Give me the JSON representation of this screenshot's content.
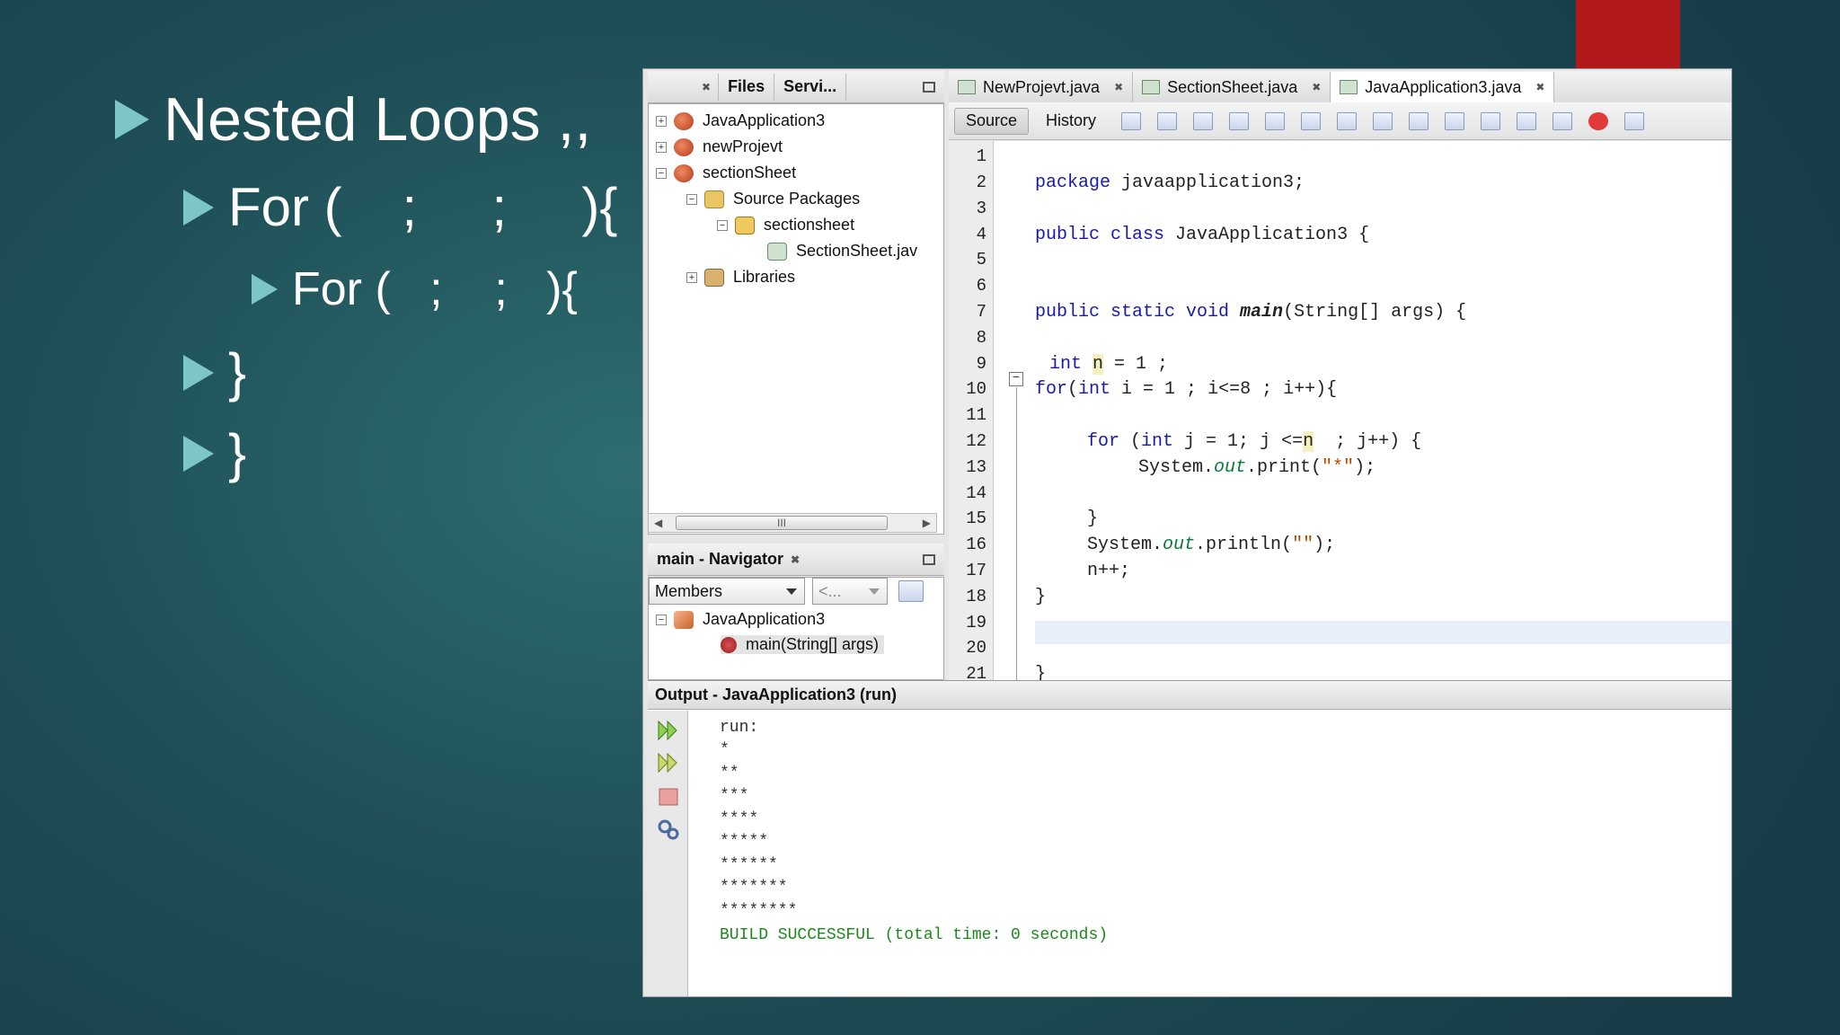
{
  "slide": {
    "bullets": [
      "Nested Loops ,,",
      "For (    ;     ;     ){",
      "For (   ;    ;   ){",
      "}",
      "}"
    ]
  },
  "ide": {
    "projects_panel": {
      "tabs": [
        "Files",
        "Servi..."
      ],
      "tree": [
        {
          "label": "JavaApplication3"
        },
        {
          "label": "newProjevt"
        },
        {
          "label": "sectionSheet"
        },
        {
          "label": "Source Packages"
        },
        {
          "label": "sectionsheet"
        },
        {
          "label": "SectionSheet.jav"
        },
        {
          "label": "Libraries"
        }
      ],
      "scroll_thumb": "III"
    },
    "navigator": {
      "title": "main - Navigator",
      "filter_select": "Members",
      "history_select": "<...",
      "tree": [
        {
          "label": "JavaApplication3"
        },
        {
          "label": "main(String[] args)"
        }
      ]
    },
    "editor_tabs": [
      "NewProjevt.java",
      "SectionSheet.java",
      "JavaApplication3.java"
    ],
    "toolbar": {
      "source": "Source",
      "history": "History"
    },
    "line_numbers": [
      "1",
      "2",
      "3",
      "4",
      "5",
      "6",
      "7",
      "8",
      "9",
      "10",
      "11",
      "12",
      "13",
      "14",
      "15",
      "16",
      "17",
      "18",
      "19",
      "20",
      "21"
    ],
    "code": {
      "l2_kw": "package",
      "l2_rest": " javaapplication3;",
      "l4_kw": "public class",
      "l4_rest": " JavaApplication3 {",
      "l7_kw": "public static void ",
      "l7_m": "main",
      "l7_rest": "(String[] args) {",
      "l9_kw": "int ",
      "l9_n": "n",
      "l9_rest": " = 1 ;",
      "l10_kw": "for",
      "l10_a": "(",
      "l10_kw2": "int",
      "l10_rest": " i = 1 ; i<=8 ; i++){",
      "l12_kw": "for",
      "l12_a": " (",
      "l12_kw2": "int",
      "l12_b": " j = 1; j <=",
      "l12_n": "n",
      "l12_rest": "  ; j++) {",
      "l13_a": "System.",
      "l13_f": "out",
      "l13_b": ".print(",
      "l13_s": "\"*\"",
      "l13_c": ");",
      "l15": "}",
      "l16_a": "System.",
      "l16_f": "out",
      "l16_b": ".println(",
      "l16_s": "\"\"",
      "l16_c": ");",
      "l17": "n++;",
      "l18": "}",
      "l21": "}"
    },
    "output": {
      "title": "Output - JavaApplication3 (run)",
      "lines": [
        "run:",
        "*",
        "**",
        "***",
        "****",
        "*****",
        "******",
        "*******",
        "********"
      ],
      "status": "BUILD SUCCESSFUL (total time: 0 seconds)"
    }
  }
}
